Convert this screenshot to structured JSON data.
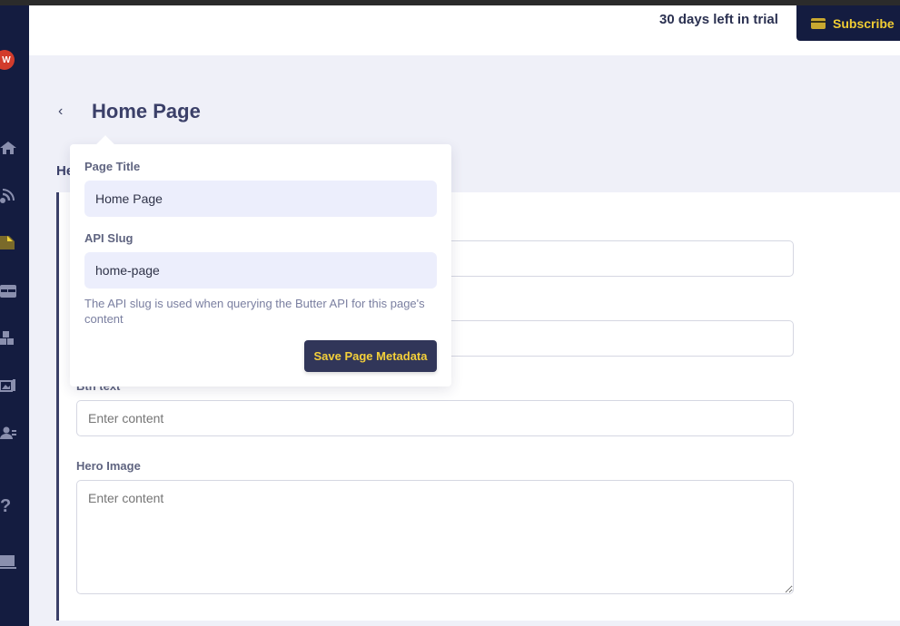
{
  "header": {
    "trial_text": "30 days left in trial",
    "subscribe_label": "Subscribe",
    "subscribe_icon": "credit-card-icon"
  },
  "sidebar": {
    "avatar_initial": "W",
    "items": [
      {
        "name": "home",
        "icon": "home-icon"
      },
      {
        "name": "feeds",
        "icon": "rss-icon"
      },
      {
        "name": "pages",
        "icon": "page-icon",
        "active": true
      },
      {
        "name": "collections",
        "icon": "table-icon"
      },
      {
        "name": "components",
        "icon": "blocks-icon"
      },
      {
        "name": "media",
        "icon": "media-icon"
      },
      {
        "name": "users",
        "icon": "users-icon"
      },
      {
        "name": "help",
        "icon": "question-icon"
      },
      {
        "name": "settings",
        "icon": "laptop-icon"
      }
    ],
    "active_color": "#f0d23a"
  },
  "page": {
    "back_icon": "chevron-left-icon",
    "title": "Home Page",
    "section_title": "He"
  },
  "popover": {
    "page_title_label": "Page Title",
    "page_title_value": "Home Page",
    "api_slug_label": "API Slug",
    "api_slug_value": "home-page",
    "help_text": "The API slug is used when querying the Butter API for this page's content",
    "save_label": "Save Page Metadata"
  },
  "fields": [
    {
      "label": "",
      "placeholder": ""
    },
    {
      "label": "",
      "placeholder": ""
    },
    {
      "label": "Btn text",
      "placeholder": "Enter content"
    },
    {
      "label": "Hero Image",
      "placeholder": "Enter content"
    }
  ],
  "colors": {
    "sidebar_bg": "#141c40",
    "accent_yellow": "#f0cc33",
    "title_color": "#3b4069",
    "page_bg": "#eff0f8"
  }
}
